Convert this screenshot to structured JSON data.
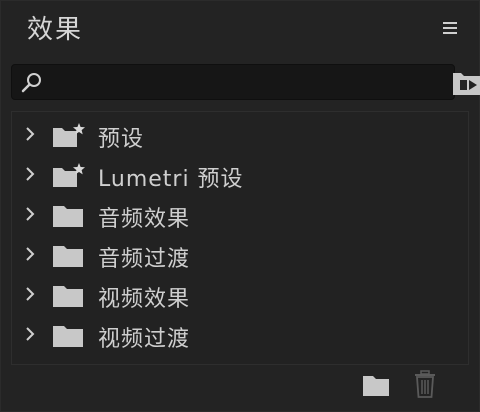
{
  "panel": {
    "title": "效果",
    "menu_icon": "hamburger-icon"
  },
  "search": {
    "value": "",
    "placeholder": "",
    "icon": "search-icon"
  },
  "toolbar": {
    "new_bin_icon": "new-custom-bin-icon"
  },
  "tree": {
    "items": [
      {
        "label": "预设",
        "icon": "preset-folder-star-icon",
        "expanded": false
      },
      {
        "label": "Lumetri 预设",
        "icon": "preset-folder-star-icon",
        "expanded": false
      },
      {
        "label": "音频效果",
        "icon": "folder-icon",
        "expanded": false
      },
      {
        "label": "音频过渡",
        "icon": "folder-icon",
        "expanded": false
      },
      {
        "label": "视频效果",
        "icon": "folder-icon",
        "expanded": false
      },
      {
        "label": "视频过渡",
        "icon": "folder-icon",
        "expanded": false
      }
    ]
  },
  "footer": {
    "new_folder_icon": "new-folder-icon",
    "delete_icon": "trash-icon"
  },
  "colors": {
    "panel_bg": "#232323",
    "search_bg": "#161616",
    "text": "#cfcfcf",
    "icon": "#c8c8c8",
    "icon_disabled": "#5a5a5a"
  }
}
